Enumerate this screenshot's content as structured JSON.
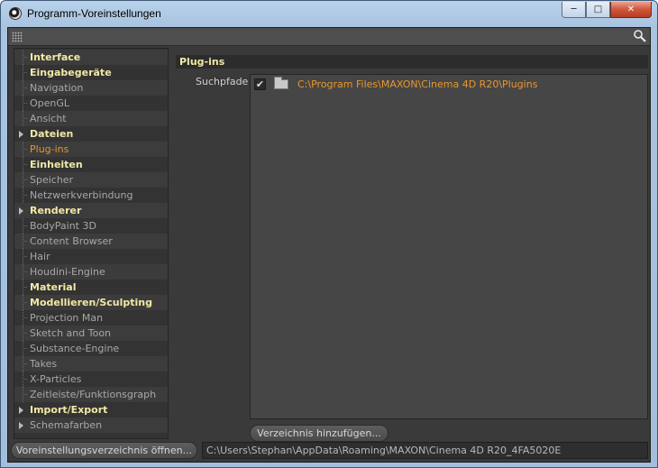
{
  "window": {
    "title": "Programm-Voreinstellungen",
    "minimize_glyph": "─",
    "maximize_glyph": "□",
    "close_glyph": "✕"
  },
  "sidebar": {
    "items": [
      {
        "label": "Interface",
        "kind": "category"
      },
      {
        "label": "Eingabegeräte",
        "kind": "category"
      },
      {
        "label": "Navigation",
        "kind": "item"
      },
      {
        "label": "OpenGL",
        "kind": "item"
      },
      {
        "label": "Ansicht",
        "kind": "item"
      },
      {
        "label": "Dateien",
        "kind": "category",
        "expandable": true
      },
      {
        "label": "Plug-ins",
        "kind": "item",
        "selected": true
      },
      {
        "label": "Einheiten",
        "kind": "category"
      },
      {
        "label": "Speicher",
        "kind": "item"
      },
      {
        "label": "Netzwerkverbindung",
        "kind": "item"
      },
      {
        "label": "Renderer",
        "kind": "category",
        "expandable": true
      },
      {
        "label": "BodyPaint 3D",
        "kind": "item"
      },
      {
        "label": "Content Browser",
        "kind": "item"
      },
      {
        "label": "Hair",
        "kind": "item"
      },
      {
        "label": "Houdini-Engine",
        "kind": "item"
      },
      {
        "label": "Material",
        "kind": "category"
      },
      {
        "label": "Modellieren/Sculpting",
        "kind": "category"
      },
      {
        "label": "Projection Man",
        "kind": "item"
      },
      {
        "label": "Sketch and Toon",
        "kind": "item"
      },
      {
        "label": "Substance-Engine",
        "kind": "item"
      },
      {
        "label": "Takes",
        "kind": "item"
      },
      {
        "label": "X-Particles",
        "kind": "item"
      },
      {
        "label": "Zeitleiste/Funktionsgraph",
        "kind": "item"
      },
      {
        "label": "Import/Export",
        "kind": "category",
        "expandable": true
      },
      {
        "label": "Schemafarben",
        "kind": "item",
        "expandable": true
      }
    ]
  },
  "panel": {
    "section_title": "Plug-ins",
    "search_paths_label": "Suchpfade",
    "paths": [
      {
        "checked": true,
        "check_glyph": "✔",
        "path": "C:\\Program Files\\MAXON\\Cinema 4D R20\\Plugins"
      }
    ],
    "add_directory_button": "Verzeichnis hinzufügen..."
  },
  "footer": {
    "open_prefs_button": "Voreinstellungsverzeichnis öffnen...",
    "prefs_path": "C:\\Users\\Stephan\\AppData\\Roaming\\MAXON\\Cinema 4D R20_4FA5020E"
  },
  "colors": {
    "category_text": "#f2e9a5",
    "item_text": "#a8a8a8",
    "selected_text": "#e9962d",
    "panel_bg": "#3a3a3a"
  },
  "icons": {
    "app": "cinema4d-logo-icon",
    "grip": "grip-dots-icon",
    "search": "search-icon",
    "folder": "folder-icon"
  }
}
